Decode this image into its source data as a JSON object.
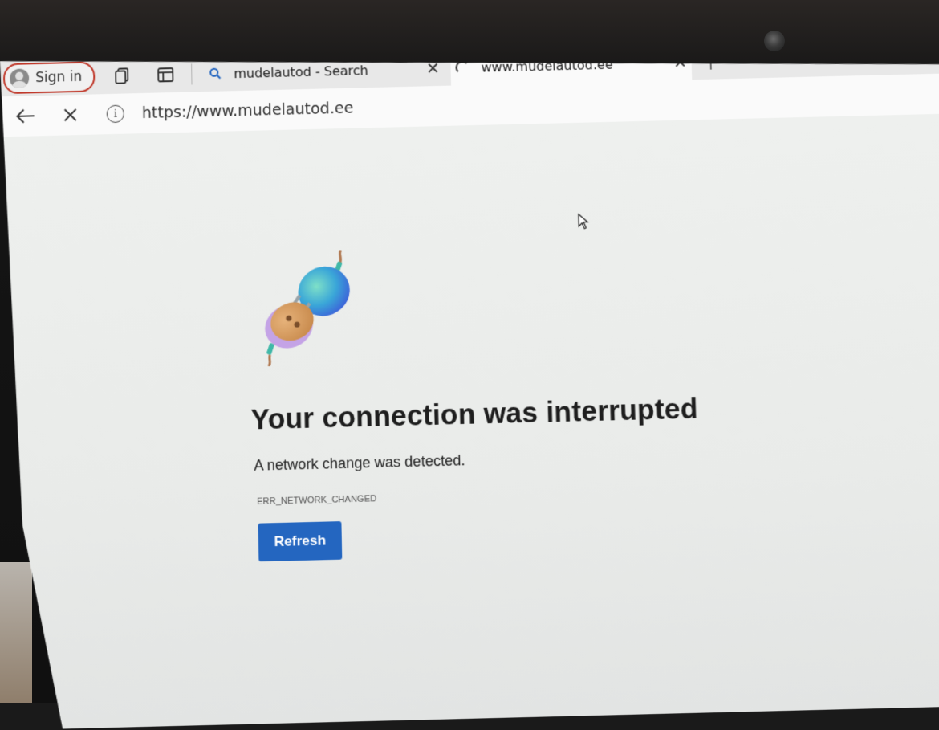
{
  "browser": {
    "profile_label": "Sign in",
    "tabs": [
      {
        "title": "mudelautod - Search",
        "favicon": "search-icon",
        "close": "✕"
      },
      {
        "title": "www.mudelautod.ee",
        "favicon": "loading-spinner-icon",
        "close": "✕",
        "active": true
      }
    ],
    "new_tab_symbol": "+",
    "address": "https://www.mudelautod.ee",
    "info_symbol": "i"
  },
  "page": {
    "heading": "Your connection was interrupted",
    "message": "A network change was detected.",
    "error_code": "ERR_NETWORK_CHANGED",
    "refresh_label": "Refresh"
  },
  "colors": {
    "accent": "#2466c0",
    "profile_border": "#c0392b"
  }
}
